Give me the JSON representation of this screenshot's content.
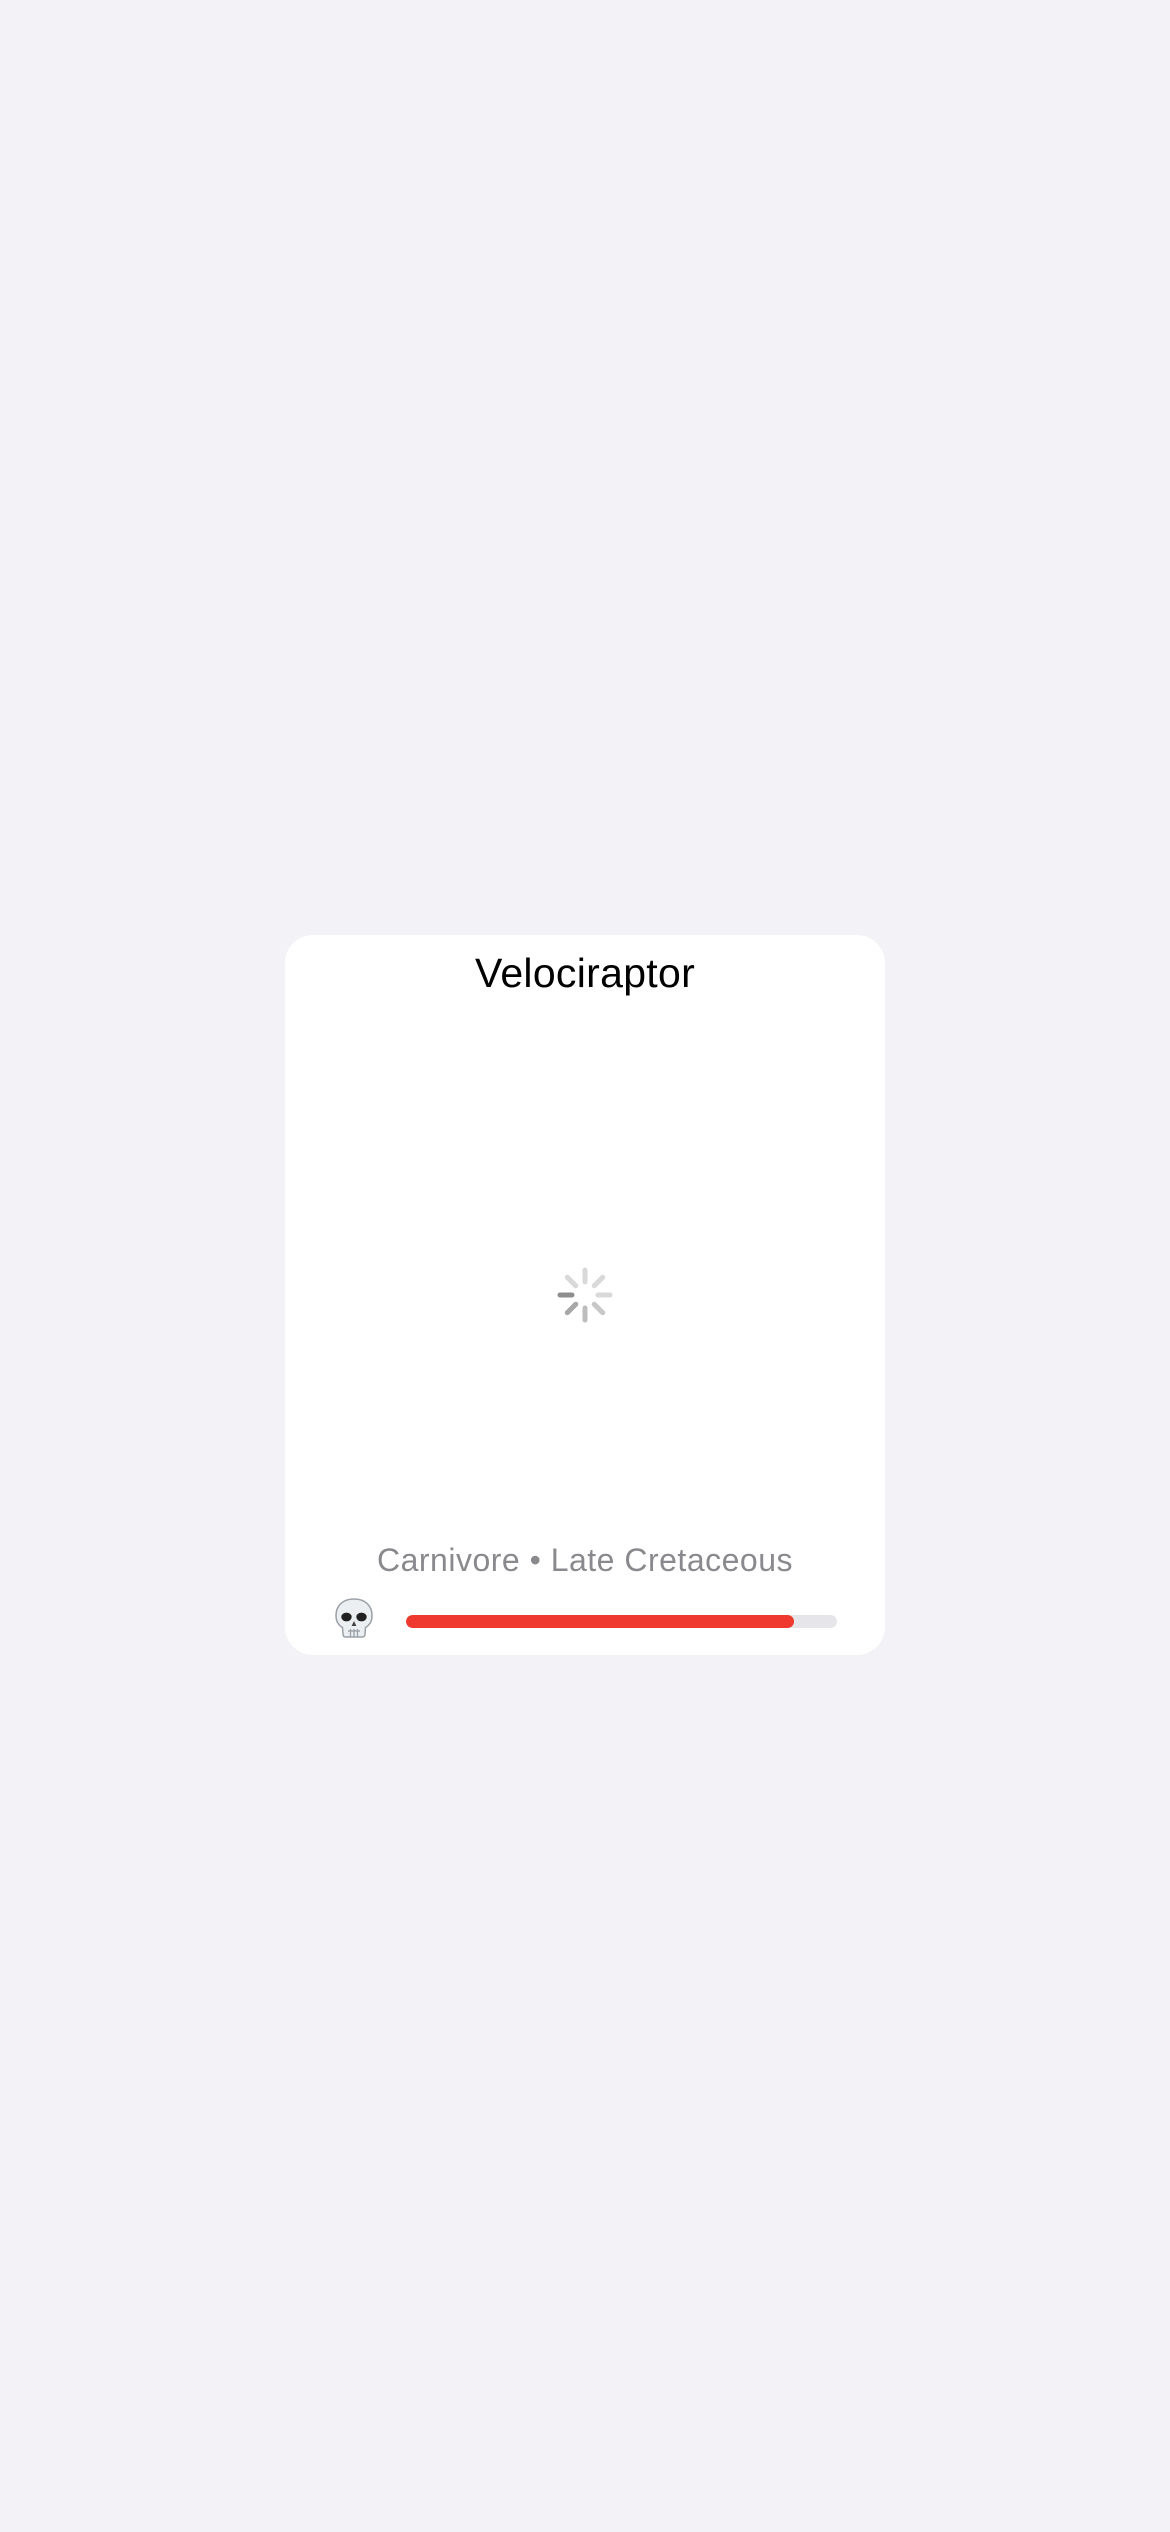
{
  "card": {
    "title": "Velociraptor",
    "subtitle": "Carnivore • Late Cretaceous",
    "loading_indicator": "activity-spinner",
    "status": {
      "icon": "skull-icon",
      "progress": 0.9,
      "progress_color": "#f0392e",
      "track_color": "#e5e5ea"
    }
  },
  "colors": {
    "background": "#f2f2f7",
    "card": "#ffffff",
    "title": "#000000",
    "subtitle": "#8a8a8e"
  }
}
